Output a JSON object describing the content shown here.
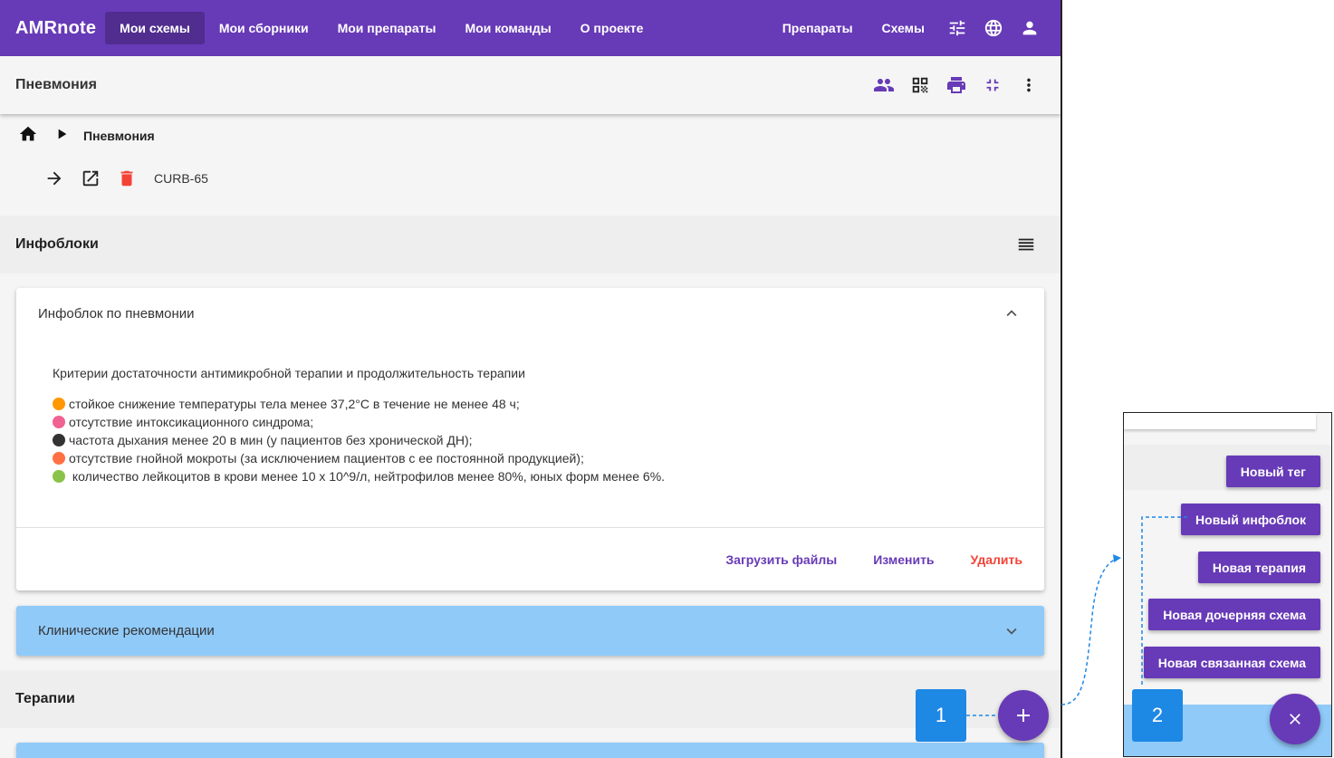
{
  "topbar": {
    "brand": "AMRnote",
    "nav": [
      "Мои схемы",
      "Мои сборники",
      "Мои препараты",
      "Мои команды",
      "О проекте"
    ],
    "right_links": [
      "Препараты",
      "Схемы"
    ],
    "icons": [
      "tune-icon",
      "globe-icon",
      "account-icon"
    ]
  },
  "subbar": {
    "title": "Пневмония",
    "icons": [
      "people-icon",
      "qr-code-icon",
      "print-icon",
      "collapse-icon",
      "more-vert-icon"
    ]
  },
  "breadcrumb": {
    "home_icon": "home-icon",
    "separator_icon": "play-arrow-icon",
    "current": "Пневмония"
  },
  "linked_schema": {
    "icons": [
      "arrow-right-icon",
      "open-in-new-icon",
      "delete-icon"
    ],
    "name": "CURB-65"
  },
  "infoblocks": {
    "title": "Инфоблоки",
    "menu_icon": "list-icon",
    "panel": {
      "title": "Инфоблок по пневмонии",
      "criteria_title": "Критерии достаточности антимикробной терапии и продолжительность терапии",
      "lines": [
        {
          "emoji_color": "#ff9800",
          "text": "стойкое снижение температуры тела менее 37,2°C в течение не менее 48 ч;"
        },
        {
          "emoji_color": "#f06292",
          "text": "отсутствие интоксикационного синдрома;"
        },
        {
          "emoji_color": "#333333",
          "text": "частота дыхания менее 20 в мин (у пациентов без хронической ДН);"
        },
        {
          "emoji_color": "#ff7043",
          "text": "отсутствие гнойной мокроты (за исключением пациентов с ее постоянной продукцией);"
        },
        {
          "emoji_color": "#8bc34a",
          "text": " количество лейкоцитов в крови менее 10 х 10^9/л, нейтрофилов менее 80%, юных форм менее 6%."
        }
      ],
      "actions": {
        "upload": "Загрузить файлы",
        "edit": "Изменить",
        "delete": "Удалить"
      }
    },
    "collapsed_panel": "Клинические рекомендации"
  },
  "therapies": {
    "title": "Терапии"
  },
  "markers": {
    "first": "1",
    "second": "2"
  },
  "inset": {
    "buttons": [
      "Новый тег",
      "Новый инфоблок",
      "Новая терапия",
      "Новая дочерняя схема",
      "Новая связанная схема"
    ]
  },
  "colors": {
    "primary": "#673ab7",
    "accent_blue": "#90caf9",
    "marker_blue": "#1e88e5",
    "danger": "#f44336"
  }
}
